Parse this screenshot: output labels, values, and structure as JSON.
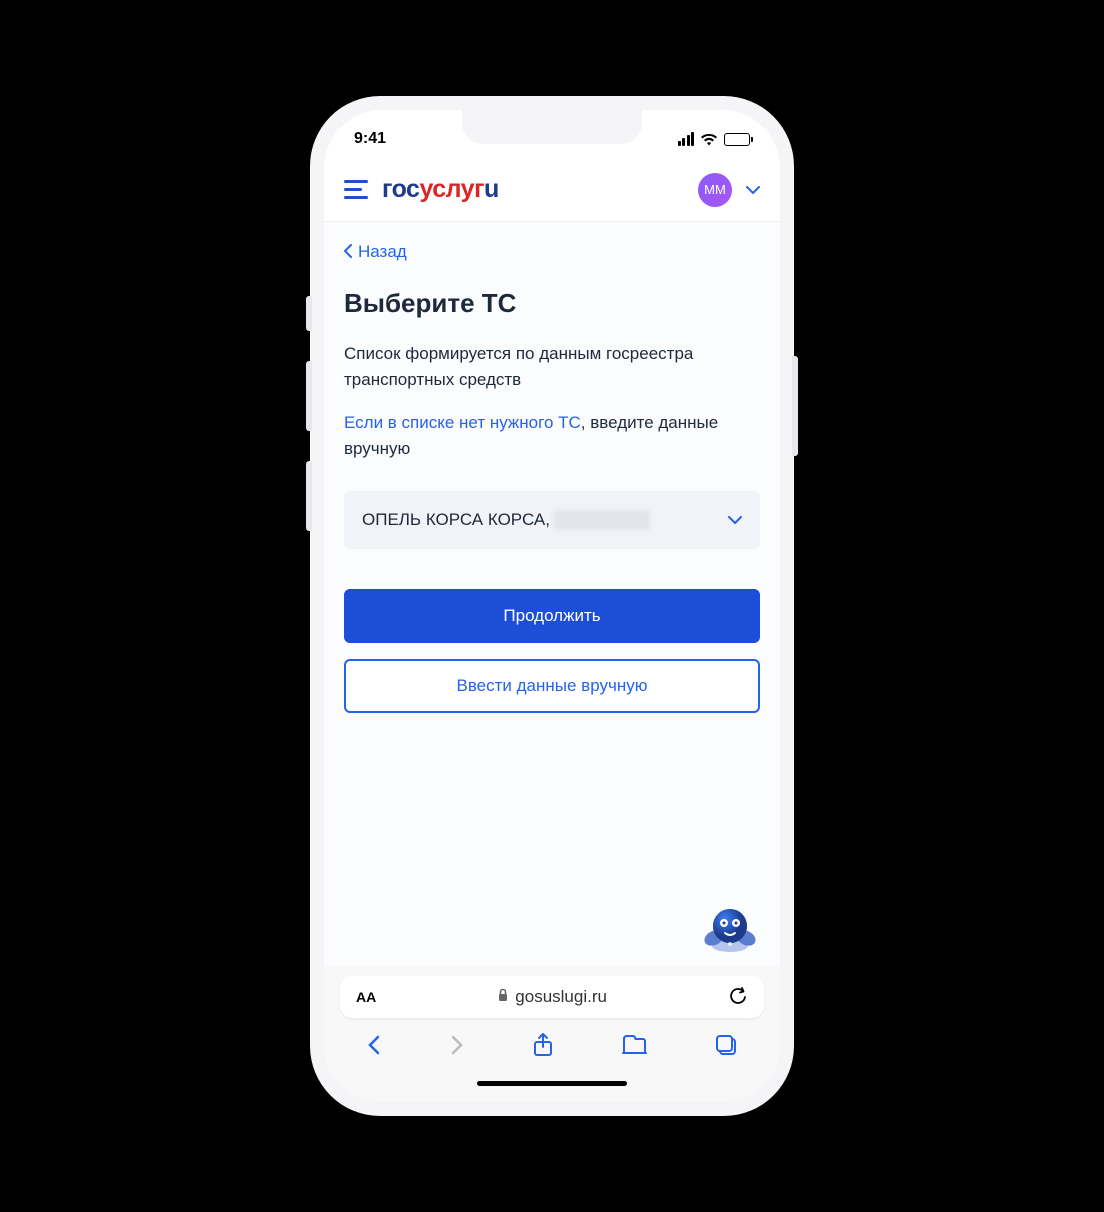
{
  "status": {
    "time": "9:41"
  },
  "header": {
    "logo_p1": "гос",
    "logo_p2": "услуг",
    "logo_p3": "u",
    "avatar_initials": "ММ"
  },
  "nav": {
    "back_label": "Назад"
  },
  "page": {
    "title": "Выберите ТС",
    "description": "Список формируется по данным госреестра транспортных средств",
    "hint_link": "Если в списке нет нужного ТС",
    "hint_rest": ", введите данные вручную"
  },
  "select": {
    "selected_label": "ОПЕЛЬ КОРСА КОРСА,"
  },
  "buttons": {
    "continue_label": "Продолжить",
    "manual_label": "Ввести данные вручную"
  },
  "browser": {
    "text_size": "AA",
    "url": "gosuslugi.ru"
  }
}
